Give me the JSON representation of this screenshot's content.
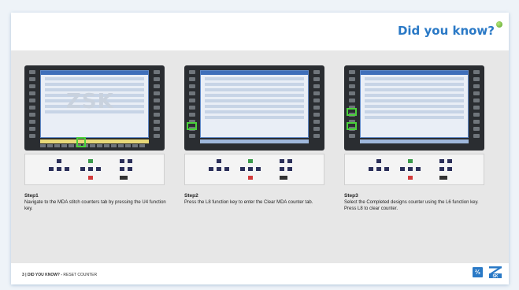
{
  "header": {
    "title": "Did you know?"
  },
  "steps": [
    {
      "title": "Step1",
      "desc": "Navigate to the MDA stitch counters tab by pressing the U4 function key."
    },
    {
      "title": "Step2",
      "desc": "Press the L8 function key to enter the Clear MDA counter tab."
    },
    {
      "title": "Step3",
      "desc": "Select the Completed designs counter using the L6 function key. Press L8 to clear counter."
    }
  ],
  "screen": {
    "watermark": "ZSK"
  },
  "footer": {
    "page": "3 | DID YOU KNOW? -",
    "topic": " RESET COUNTER"
  },
  "colors": {
    "accent": "#2a79c6",
    "highlight": "#4bd13b"
  }
}
